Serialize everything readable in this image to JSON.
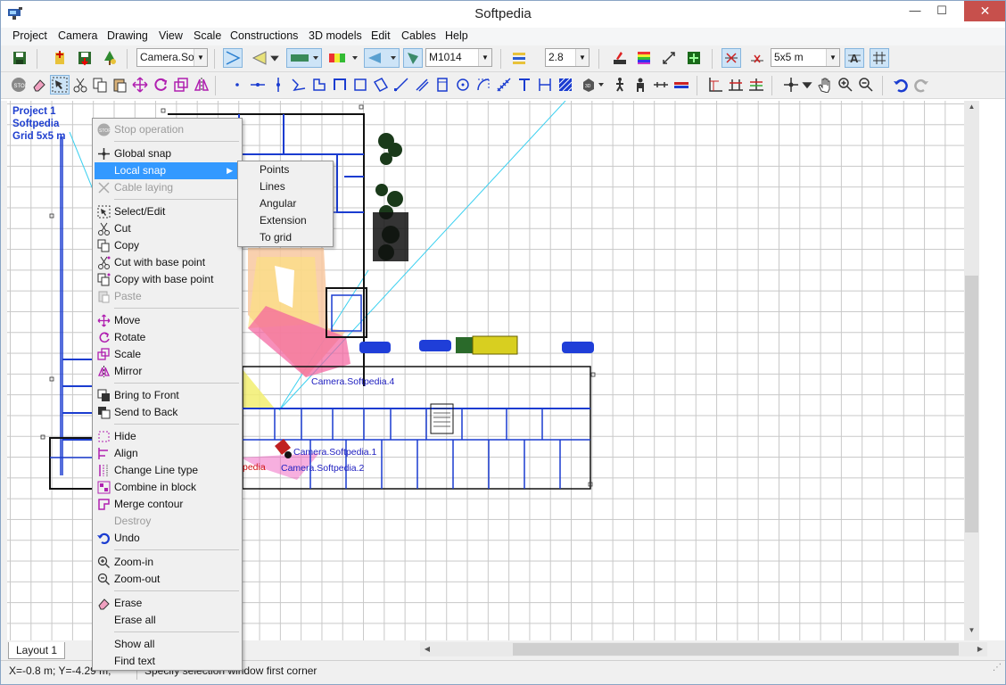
{
  "window": {
    "title": "Softpedia",
    "min": "—",
    "max": "☐",
    "close": "✕"
  },
  "menubar": [
    "Project",
    "Camera",
    "Drawing",
    "View",
    "Scale",
    "Constructions",
    "3D models",
    "Edit",
    "Cables",
    "Help"
  ],
  "toolbar": {
    "camera_select": "Camera.Softp",
    "lens_value": "2.8",
    "model_value": "M1014",
    "grid_value": "5x5 m"
  },
  "project_info": {
    "line1": "Project 1",
    "line2": "Softpedia",
    "line3": "Grid 5x5 m"
  },
  "canvas": {
    "camera_labels": [
      "Camera.Softpedia.4",
      "Camera.Softpedia.1",
      "Camera.Softpedia.2",
      "pedia"
    ]
  },
  "context_menu": {
    "items": [
      {
        "label": "Stop operation",
        "disabled": true
      },
      {
        "label": "Global snap"
      },
      {
        "label": "Local snap",
        "highlight": true
      },
      {
        "label": "Cable laying",
        "disabled": true
      },
      {
        "label": "Select/Edit"
      },
      {
        "label": "Cut"
      },
      {
        "label": "Copy"
      },
      {
        "label": "Cut with base point"
      },
      {
        "label": "Copy with base point"
      },
      {
        "label": "Paste",
        "disabled": true
      },
      {
        "label": "Move"
      },
      {
        "label": "Rotate"
      },
      {
        "label": "Scale"
      },
      {
        "label": "Mirror"
      },
      {
        "label": "Bring to Front"
      },
      {
        "label": "Send to Back"
      },
      {
        "label": "Hide"
      },
      {
        "label": "Align"
      },
      {
        "label": "Change Line type"
      },
      {
        "label": "Combine in block"
      },
      {
        "label": "Merge contour"
      },
      {
        "label": "Destroy",
        "disabled": true
      },
      {
        "label": "Undo"
      },
      {
        "label": "Zoom-in"
      },
      {
        "label": "Zoom-out"
      },
      {
        "label": "Erase"
      },
      {
        "label": "Erase all"
      },
      {
        "label": "Show all"
      },
      {
        "label": "Find text"
      }
    ]
  },
  "submenu": {
    "items": [
      "Points",
      "Lines",
      "Angular",
      "Extension",
      "To grid"
    ]
  },
  "layout_tab": "Layout 1",
  "status": {
    "coords": "X=-0.8 m; Y=-4.29 m;",
    "hint": "Specify selection window first corner"
  }
}
